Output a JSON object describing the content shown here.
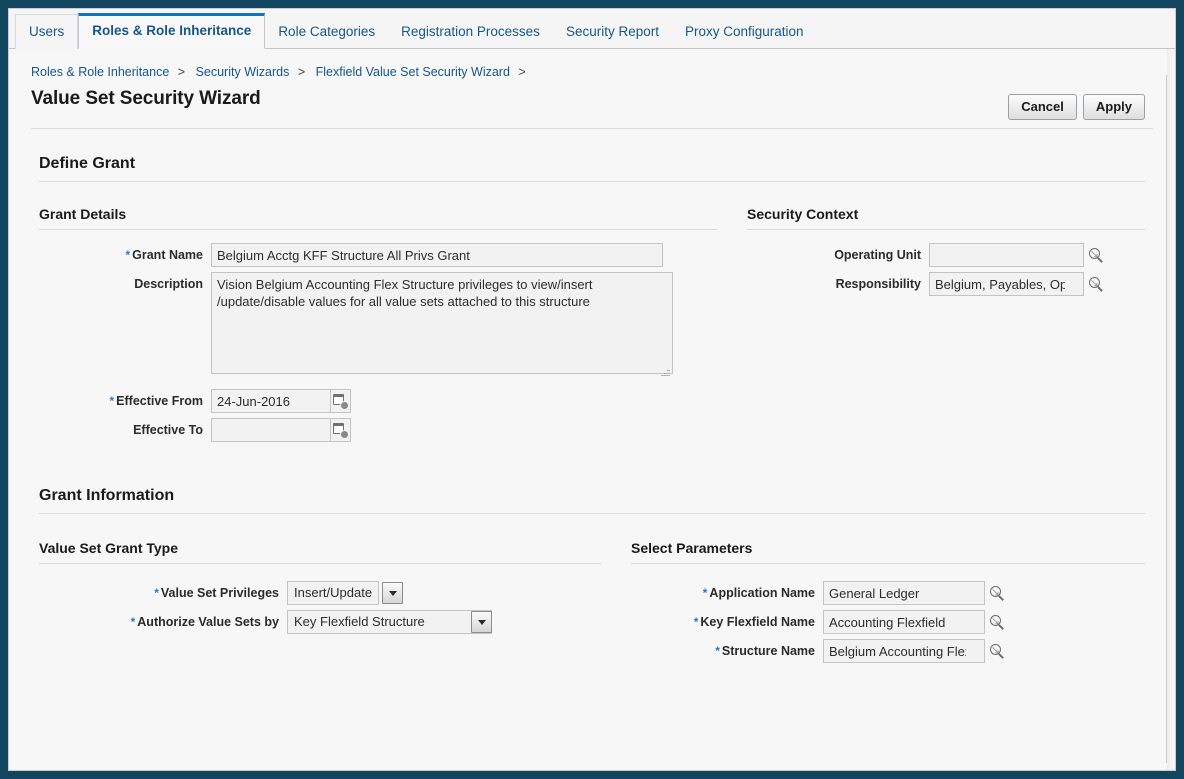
{
  "tabs": [
    {
      "label": "Users",
      "active": false
    },
    {
      "label": "Roles & Role Inheritance",
      "active": true
    },
    {
      "label": "Role Categories",
      "active": false
    },
    {
      "label": "Registration Processes",
      "active": false
    },
    {
      "label": "Security Report",
      "active": false
    },
    {
      "label": "Proxy Configuration",
      "active": false
    }
  ],
  "breadcrumb": {
    "items": [
      "Roles & Role Inheritance",
      "Security Wizards",
      "Flexfield Value Set Security Wizard"
    ],
    "separator": ">"
  },
  "page": {
    "title": "Value Set Security Wizard",
    "cancel_label": "Cancel",
    "apply_label": "Apply"
  },
  "define_grant": {
    "heading": "Define Grant",
    "grant_details": {
      "heading": "Grant Details",
      "grant_name": {
        "label": "Grant Name",
        "required": true,
        "value": "Belgium Acctg KFF Structure All Privs Grant"
      },
      "description": {
        "label": "Description",
        "required": false,
        "value": "Vision Belgium Accounting Flex Structure privileges to view/insert /update/disable values for all value sets attached to this structure"
      },
      "effective_from": {
        "label": "Effective From",
        "required": true,
        "value": "24-Jun-2016"
      },
      "effective_to": {
        "label": "Effective To",
        "required": false,
        "value": ""
      }
    },
    "security_context": {
      "heading": "Security Context",
      "operating_unit": {
        "label": "Operating Unit",
        "required": false,
        "value": ""
      },
      "responsibility": {
        "label": "Responsibility",
        "required": false,
        "value": "Belgium, Payables, Opera"
      }
    }
  },
  "grant_information": {
    "heading": "Grant Information",
    "value_set_grant_type": {
      "heading": "Value Set Grant Type",
      "value_set_privileges": {
        "label": "Value Set Privileges",
        "required": true,
        "value": "Insert/Update"
      },
      "authorize_value_sets_by": {
        "label": "Authorize Value Sets by",
        "required": true,
        "value": "Key Flexfield Structure"
      }
    },
    "select_parameters": {
      "heading": "Select Parameters",
      "application_name": {
        "label": "Application Name",
        "required": true,
        "value": "General Ledger"
      },
      "key_flexfield_name": {
        "label": "Key Flexfield Name",
        "required": true,
        "value": "Accounting Flexfield"
      },
      "structure_name": {
        "label": "Structure Name",
        "required": true,
        "value": "Belgium Accounting Flex"
      }
    }
  },
  "icons": {
    "search": "search-icon",
    "calendar": "calendar-icon",
    "dropdown": "chevron-down-icon",
    "lov": "lov-arrow-icon"
  },
  "colors": {
    "frame": "#14455f",
    "accent": "#1074bd",
    "link": "#15568d",
    "required": "#2878c8"
  }
}
